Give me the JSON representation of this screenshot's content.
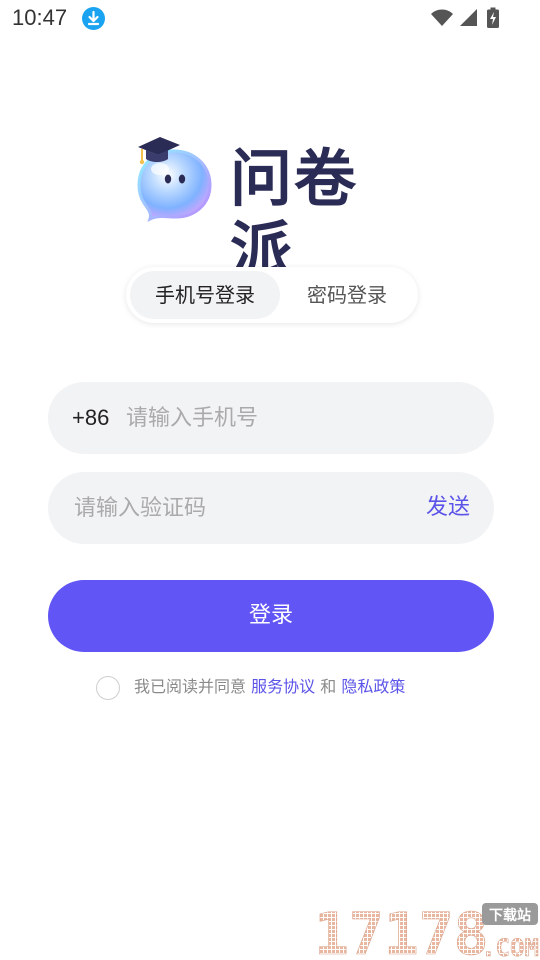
{
  "status_bar": {
    "time": "10:47"
  },
  "icons": {
    "download": "download-icon",
    "wifi": "wifi-icon",
    "signal": "signal-icon",
    "battery": "battery-charging-icon",
    "mascot": "mascot-logo-icon"
  },
  "app": {
    "name": "问卷派"
  },
  "tabs": [
    {
      "label": "手机号登录",
      "active": true
    },
    {
      "label": "密码登录",
      "active": false
    }
  ],
  "phone": {
    "prefix": "+86",
    "value": "",
    "placeholder": "请输入手机号"
  },
  "code": {
    "value": "",
    "placeholder": "请输入验证码",
    "send_label": "发送"
  },
  "login": {
    "label": "登录"
  },
  "agreement": {
    "checked": false,
    "prefix": "我已阅读并同意",
    "terms": "服务协议",
    "and": "和",
    "privacy": "隐私政策"
  },
  "watermark": {
    "number": "17178",
    "tag": "下载站",
    "domain": ".COM"
  },
  "colors": {
    "primary": "#6155f5",
    "link": "#5c54e8",
    "input_bg": "#f2f3f5",
    "title": "#2b2c55"
  }
}
